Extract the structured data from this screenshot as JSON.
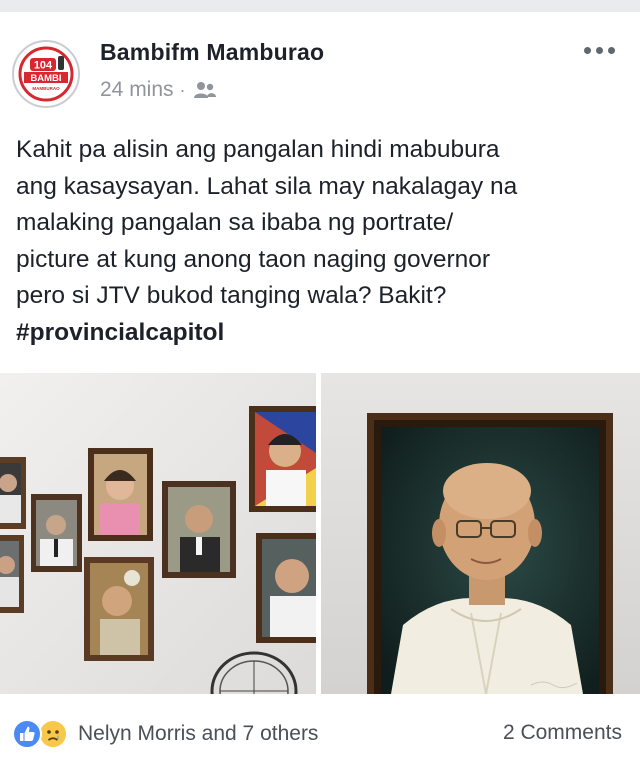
{
  "post": {
    "page_name": "Bambifm Mamburao",
    "time": "24 mins",
    "separator": "·",
    "avatar_label_top": "104",
    "avatar_label_mid": "BAMBI",
    "avatar_label_bottom": "MAMBURAO",
    "text_lines": [
      "Kahit pa alisin ang pangalan hindi mabubura",
      "ang kasaysayan. Lahat sila may nakalagay na",
      "malaking pangalan sa ibaba ng portrate/",
      "picture at kung anong taon naging governor",
      "pero si JTV bukod tanging wala? Bakit?"
    ],
    "hashtag": "#provincialcapitol"
  },
  "icons": {
    "audience": "friends-icon",
    "more": "more-options-icon",
    "like": "like-reaction-icon",
    "sad": "sad-reaction-icon"
  },
  "footer": {
    "reactions_text": "Nelyn Morris and 7 others",
    "comments_text": "2 Comments"
  },
  "colors": {
    "like_blue": "#4a8af4",
    "sad_yellow": "#f7c84a",
    "meta_gray": "#90949c"
  }
}
